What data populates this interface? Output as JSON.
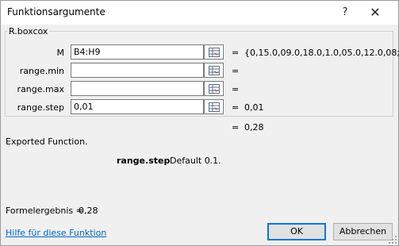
{
  "window": {
    "title": "Funktionsargumente",
    "help_button": "?",
    "close_button": "✕"
  },
  "function_group": {
    "label": "R.boxcox",
    "args": [
      {
        "label": "M",
        "value": "B4:H9",
        "result": "{0,15.0,09.0,18.0,1.0,05.0,12.0,08;"
      },
      {
        "label": "range.min",
        "value": "",
        "result": ""
      },
      {
        "label": "range.max",
        "value": "",
        "result": ""
      },
      {
        "label": "range.step",
        "value": "0,01",
        "result": "0,01"
      }
    ],
    "equals": "=",
    "overall_result": "0,28"
  },
  "description": {
    "text": "Exported Function.",
    "param_name": "range.step",
    "param_desc": "Default 0.1."
  },
  "footer": {
    "formula_label": "Formelergebnis =",
    "formula_value": "0,28",
    "help_link": "Hilfe für diese Funktion",
    "ok_label": "OK",
    "cancel_label": "Abbrechen"
  }
}
